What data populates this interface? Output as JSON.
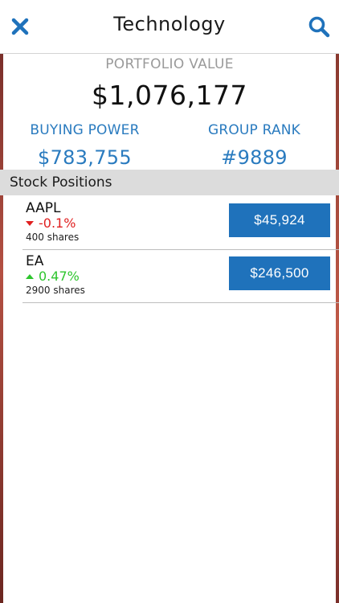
{
  "header": {
    "title": "Technology",
    "close_icon": "close-icon",
    "search_icon": "search-icon"
  },
  "portfolio": {
    "label": "PORTFOLIO VALUE",
    "value": "$1,076,177"
  },
  "stats": {
    "buying_power_label": "BUYING POWER",
    "buying_power_value": "$783,755",
    "group_rank_label": "GROUP RANK",
    "group_rank_value": "#9889"
  },
  "positions": {
    "section_title": "Stock Positions",
    "items": [
      {
        "ticker": "AAPL",
        "change": "-0.1%",
        "direction": "down",
        "shares": "400 shares",
        "value": "$45,924"
      },
      {
        "ticker": "EA",
        "change": "0.47%",
        "direction": "up",
        "shares": "2900 shares",
        "value": "$246,500"
      }
    ]
  },
  "colors": {
    "accent_blue": "#2a7bbf",
    "button_blue": "#1f72bb",
    "negative_red": "#e02020",
    "positive_green": "#2ec52e",
    "section_gray": "#dcdcdc"
  }
}
